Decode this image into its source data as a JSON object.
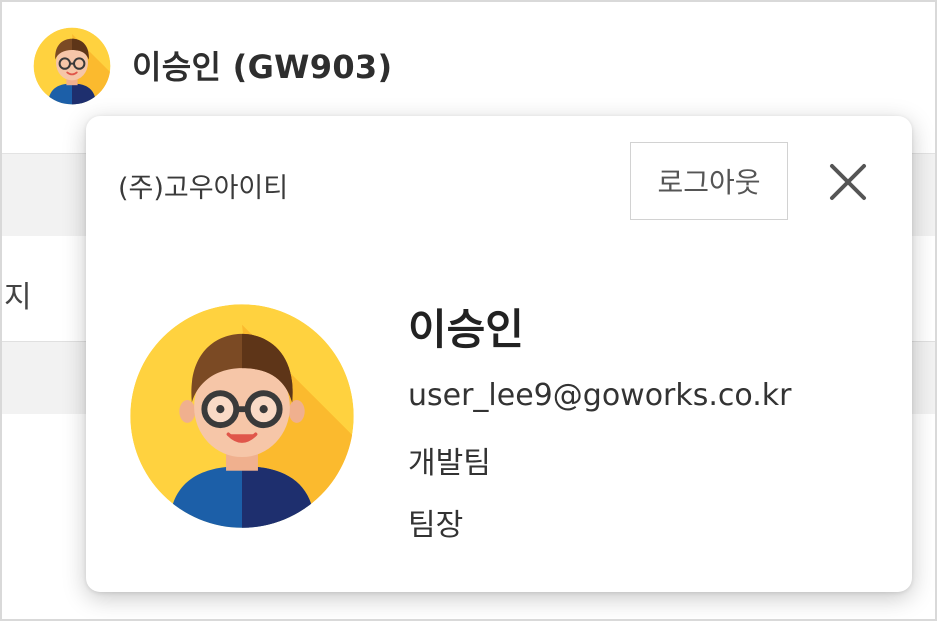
{
  "header": {
    "user_label": "이승인 (GW903)",
    "avatar_icon": "user-avatar-icon"
  },
  "background": {
    "partial_text": "지"
  },
  "popup": {
    "company": "(주)고우아이티",
    "logout_label": "로그아웃",
    "close_icon": "close-icon",
    "profile": {
      "name": "이승인",
      "email": "user_lee9@goworks.co.kr",
      "department": "개발팀",
      "position": "팀장"
    }
  },
  "colors": {
    "avatar_bg": "#FFD23F",
    "avatar_bg_shade": "#FBBA2E",
    "hair": "#7B4A24",
    "skin": "#F6C6A8",
    "shirt_left": "#1C5FA8",
    "shirt_right": "#1E2F6E",
    "glasses": "#3A3A3A"
  }
}
